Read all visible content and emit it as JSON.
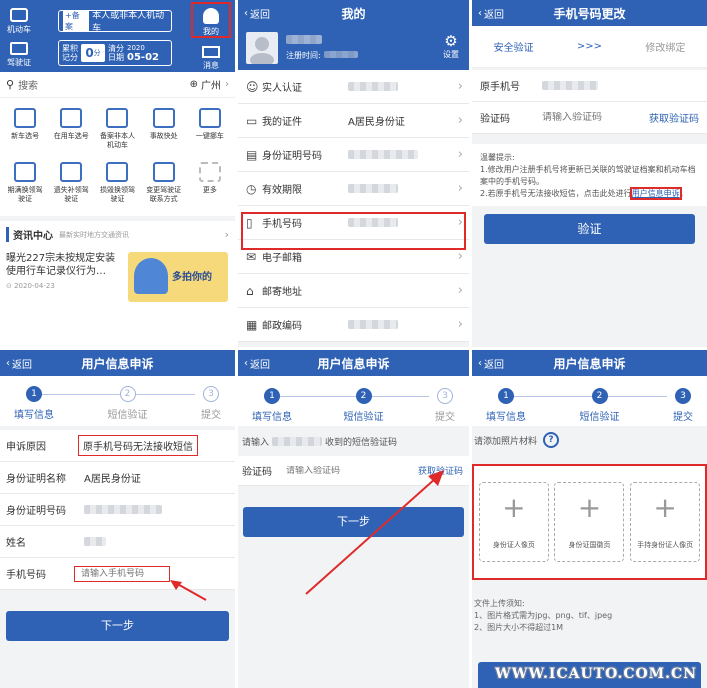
{
  "p1": {
    "top": {
      "vehicle_label": "机动车",
      "license_label": "驾驶证",
      "register_btn_badge": "+备案",
      "register_btn_text": "本人或非本人机动车",
      "score_label": "累积记分",
      "score_value": "0",
      "score_unit": "分",
      "clear_label": "清分日期",
      "clear_year": "2020",
      "clear_date": "05-02",
      "mine_label": "我的",
      "msg_label": "消息"
    },
    "search": {
      "placeholder": "搜索",
      "city": "广州"
    },
    "grid": [
      {
        "label": "新车选号",
        "icon": "car-number-icon"
      },
      {
        "label": "在用车选号",
        "icon": "car-icon"
      },
      {
        "label": "备案非本人机动车",
        "icon": "record-icon"
      },
      {
        "label": "事故快处",
        "icon": "accident-icon"
      },
      {
        "label": "一键挪车",
        "icon": "move-car-icon"
      },
      {
        "label": "期满换领驾驶证",
        "icon": "renew-icon"
      },
      {
        "label": "遗失补领驾驶证",
        "icon": "lost-icon"
      },
      {
        "label": "损毁换领驾驶证",
        "icon": "damaged-icon"
      },
      {
        "label": "变更驾驶证联系方式",
        "icon": "contact-icon"
      },
      {
        "label": "更多",
        "icon": "more-icon"
      }
    ],
    "news": {
      "title": "资讯中心",
      "subtitle": "最新实时地方交通资讯",
      "headline": "曝光227宗未按规定安装使用行车记录仪行为…",
      "date": "2020-04-23",
      "banner_text": "多拍你的"
    }
  },
  "p2": {
    "back": "返回",
    "title": "我的",
    "reg_time_label": "注册时间:",
    "settings": "设置",
    "items": [
      {
        "label": "实人认证",
        "value": ""
      },
      {
        "label": "我的证件",
        "value": "A居民身份证"
      },
      {
        "label": "身份证明号码",
        "value": ""
      },
      {
        "label": "有效期限",
        "value": ""
      },
      {
        "label": "手机号码",
        "value": ""
      },
      {
        "label": "电子邮箱",
        "value": ""
      },
      {
        "label": "邮寄地址",
        "value": ""
      },
      {
        "label": "邮政编码",
        "value": ""
      }
    ]
  },
  "p3": {
    "back": "返回",
    "title": "手机号码更改",
    "tab_verify": "安全验证",
    "tab_arrow": ">>>",
    "tab_modify": "修改绑定",
    "orig_label": "原手机号",
    "code_label": "验证码",
    "code_placeholder": "请输入验证码",
    "get_code": "获取验证码",
    "tips_title": "温馨提示:",
    "tip1": "1.修改用户注册手机号将更新已关联的驾驶证档案和机动车档案中的手机号码。",
    "tip2_pre": "2.若原手机号无法接收短信，点击此处进行",
    "tip2_link": "用户信息申诉",
    "tip2_end": "。",
    "verify_btn": "验证"
  },
  "p4": {
    "back": "返回",
    "title": "用户信息申诉",
    "steps": [
      {
        "n": "1",
        "label": "填写信息"
      },
      {
        "n": "2",
        "label": "短信验证"
      },
      {
        "n": "3",
        "label": "提交"
      }
    ],
    "reason_label": "申诉原因",
    "reason_value": "原手机号码无法接收短信",
    "idname_label": "身份证明名称",
    "idname_value": "A居民身份证",
    "idnum_label": "身份证明号码",
    "name_label": "姓名",
    "phone_label": "手机号码",
    "phone_placeholder": "请输入手机号码",
    "next": "下一步"
  },
  "p5": {
    "back": "返回",
    "title": "用户信息申诉",
    "steps": [
      {
        "n": "1",
        "label": "填写信息"
      },
      {
        "n": "2",
        "label": "短信验证"
      },
      {
        "n": "3",
        "label": "提交"
      }
    ],
    "input_pre": "请输入",
    "input_post": "收到的短信验证码",
    "code_label": "验证码",
    "code_placeholder": "请输入验证码",
    "get_code": "获取验证码",
    "next": "下一步"
  },
  "p6": {
    "back": "返回",
    "title": "用户信息申诉",
    "steps": [
      {
        "n": "1",
        "label": "填写信息"
      },
      {
        "n": "2",
        "label": "短信验证"
      },
      {
        "n": "3",
        "label": "提交"
      }
    ],
    "add_label": "请添加照片材料",
    "photos": [
      "身份证人像页",
      "身份证国徽页",
      "手持身份证人像页"
    ],
    "notes_title": "文件上传须知:",
    "note1": "1、图片格式需为jpg、png、tif、jpeg",
    "note2": "2、图片大小不得超过1M"
  },
  "watermark": "WWW.ICAUTO.COM.CN",
  "colors": {
    "primary": "#2f62b4",
    "highlight": "#e02a2a"
  }
}
